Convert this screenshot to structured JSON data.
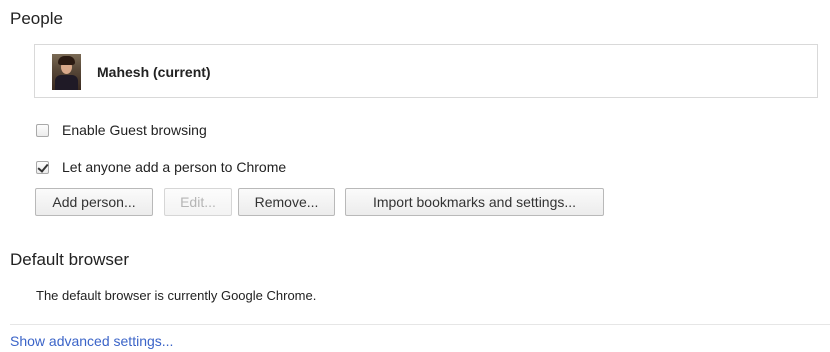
{
  "people": {
    "title": "People",
    "current_user": "Mahesh (current)",
    "guest_browsing": {
      "label": "Enable Guest browsing",
      "checked": false
    },
    "anyone_add": {
      "label": "Let anyone add a person to Chrome",
      "checked": true
    },
    "buttons": {
      "add": "Add person...",
      "edit": "Edit...",
      "remove": "Remove...",
      "import": "Import bookmarks and settings..."
    }
  },
  "default_browser": {
    "title": "Default browser",
    "status": "The default browser is currently Google Chrome."
  },
  "advanced_link": "Show advanced settings...",
  "colors": {
    "link": "#3b64c8",
    "disabled_text": "#b5b5b5"
  }
}
